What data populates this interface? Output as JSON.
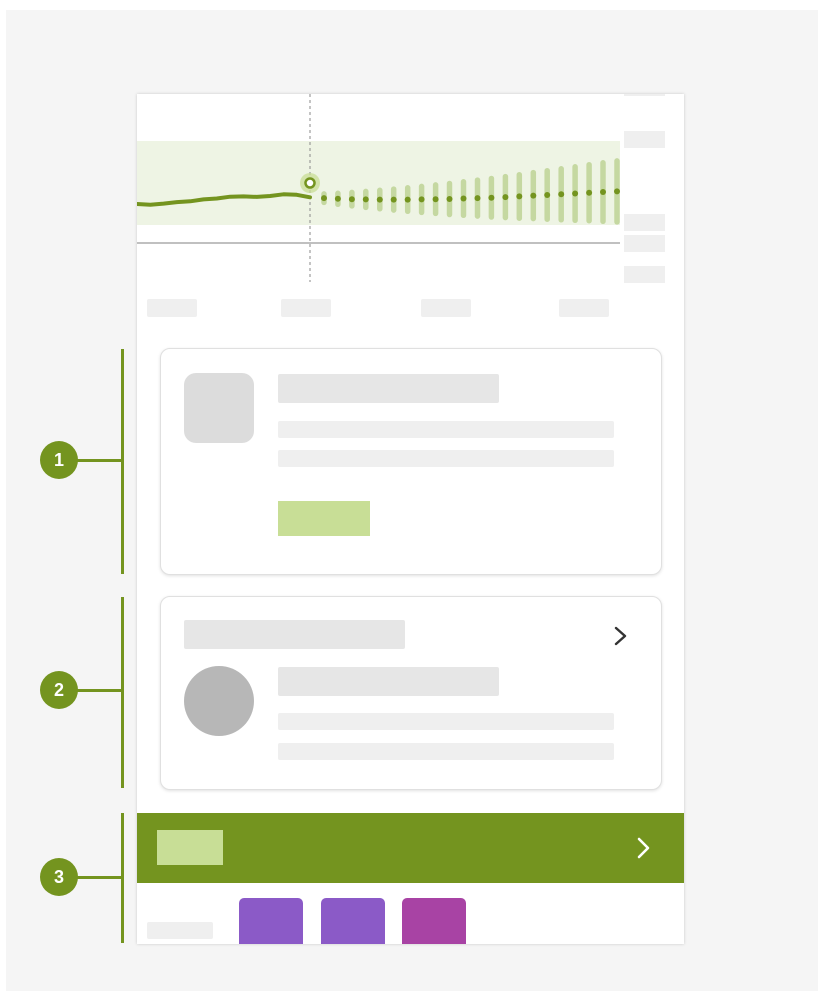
{
  "colors": {
    "accent": "#74941f",
    "accent_light": "#c8de96",
    "band": "#eef4e4",
    "tile_violet": "#8b5ac7",
    "tile_magenta": "#a843a4",
    "placeholder": "#e6e6e6",
    "avatar": "#b7b7b7"
  },
  "callouts": [
    {
      "number": "1"
    },
    {
      "number": "2"
    },
    {
      "number": "3"
    }
  ],
  "icons": {
    "card_chevron": "chevron-right-icon",
    "banner_chevron": "chevron-right-icon"
  },
  "chart_data": {
    "type": "line",
    "history": [
      0.0,
      -0.4,
      0.2,
      0.9,
      1.3,
      2.2,
      2.6,
      3.5,
      3.6,
      3.4,
      3.8,
      4.6,
      4.4,
      3.2
    ],
    "forecast": [
      3.2,
      2.8,
      2.5,
      2.3,
      2.2,
      2.1,
      2.1,
      2.1,
      2.2,
      2.3,
      2.4,
      2.6,
      2.8,
      3.0,
      3.3,
      3.6,
      4.0,
      4.3,
      4.6,
      5.0,
      5.4,
      5.7,
      6.0
    ],
    "ylim": [
      -10,
      30
    ],
    "grid": false
  }
}
